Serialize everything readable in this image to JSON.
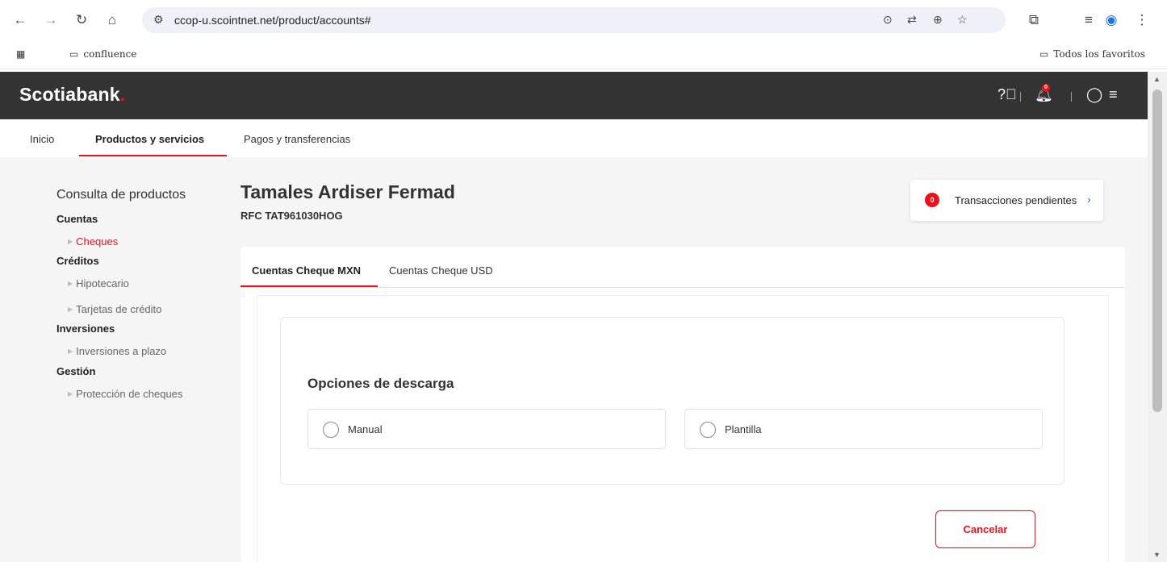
{
  "browser": {
    "url": "ccop-u.scointnet.net/product/accounts#",
    "bookmarks": [
      {
        "label": "confluence"
      }
    ],
    "favorites_label": "Todos los favoritos"
  },
  "header": {
    "brand": "Scotiabank",
    "brand_dot": ".",
    "notification_count": "0"
  },
  "top_nav": {
    "items": [
      {
        "label": "Inicio"
      },
      {
        "label": "Productos y servicios",
        "active": true
      },
      {
        "label": "Pagos y transferencias"
      }
    ]
  },
  "sidebar": {
    "title": "Consulta de productos",
    "groups": [
      {
        "label": "Cuentas",
        "items": [
          {
            "label": "Cheques",
            "active": true
          }
        ]
      },
      {
        "label": "Créditos",
        "items": [
          {
            "label": "Hipotecario"
          },
          {
            "label": "Tarjetas de crédito"
          }
        ]
      },
      {
        "label": "Inversiones",
        "items": [
          {
            "label": "Inversiones a plazo"
          }
        ]
      },
      {
        "label": "Gestión",
        "items": [
          {
            "label": "Protección de cheques"
          }
        ]
      }
    ]
  },
  "main": {
    "company_name": "Tamales Ardiser Fermad",
    "rfc": "RFC TAT961030HOG",
    "pending": {
      "count": "0",
      "label": "Transacciones pendientes"
    },
    "tabs": [
      {
        "label": "Cuentas Cheque MXN",
        "active": true
      },
      {
        "label": "Cuentas Cheque USD"
      }
    ],
    "download_options": {
      "title": "Opciones de descarga",
      "options": [
        {
          "label": "Manual"
        },
        {
          "label": "Plantilla"
        }
      ]
    },
    "cancel_label": "Cancelar"
  },
  "colors": {
    "brand_red": "#ec111a",
    "header_bg": "#333333"
  }
}
